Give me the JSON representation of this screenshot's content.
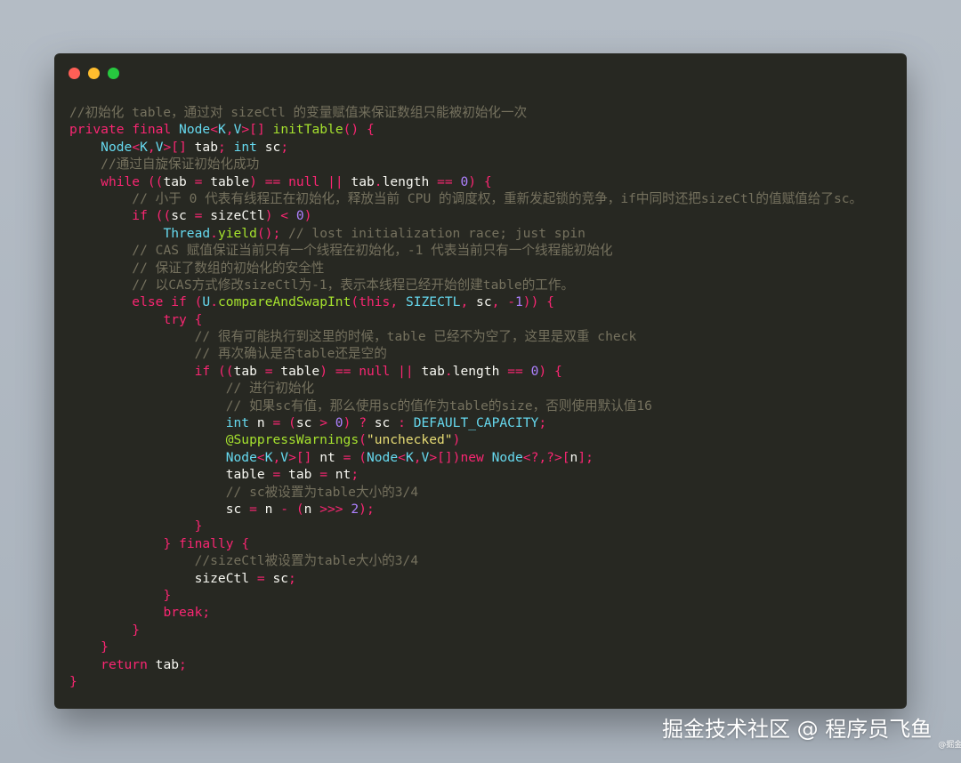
{
  "window": {
    "traffic_lights": [
      "close",
      "minimize",
      "maximize"
    ]
  },
  "code_lines": [
    "//初始化 table，通过对 sizeCtl 的变量赋值来保证数组只能被初始化一次",
    "private final Node<K,V>[] initTable() {",
    "    Node<K,V>[] tab; int sc;",
    "    //通过自旋保证初始化成功",
    "    while ((tab = table) == null || tab.length == 0) {",
    "        // 小于 0 代表有线程正在初始化，释放当前 CPU 的调度权，重新发起锁的竞争，if中同时还把sizeCtl的值赋值给了sc。",
    "        if ((sc = sizeCtl) < 0)",
    "            Thread.yield(); // lost initialization race; just spin",
    "        // CAS 赋值保证当前只有一个线程在初始化，-1 代表当前只有一个线程能初始化",
    "        // 保证了数组的初始化的安全性",
    "        // 以CAS方式修改sizeCtl为-1，表示本线程已经开始创建table的工作。",
    "        else if (U.compareAndSwapInt(this, SIZECTL, sc, -1)) {",
    "            try {",
    "                // 很有可能执行到这里的时候，table 已经不为空了，这里是双重 check",
    "                // 再次确认是否table还是空的",
    "                if ((tab = table) == null || tab.length == 0) {",
    "                    // 进行初始化",
    "                    // 如果sc有值，那么使用sc的值作为table的size，否则使用默认值16",
    "                    int n = (sc > 0) ? sc : DEFAULT_CAPACITY;",
    "                    @SuppressWarnings(\"unchecked\")",
    "                    Node<K,V>[] nt = (Node<K,V>[])new Node<?,?>[n];",
    "                    table = tab = nt;",
    "                    // sc被设置为table大小的3/4",
    "                    sc = n - (n >>> 2);",
    "                }",
    "            } finally {",
    "                //sizeCtl被设置为table大小的3/4",
    "                sizeCtl = sc;",
    "            }",
    "            break;",
    "        }",
    "    }",
    "    return tab;",
    "}"
  ],
  "watermark": {
    "text": "掘金技术社区 @ 程序员飞鱼",
    "icon": "wechat-icon",
    "small": "@掘金技术社区"
  }
}
